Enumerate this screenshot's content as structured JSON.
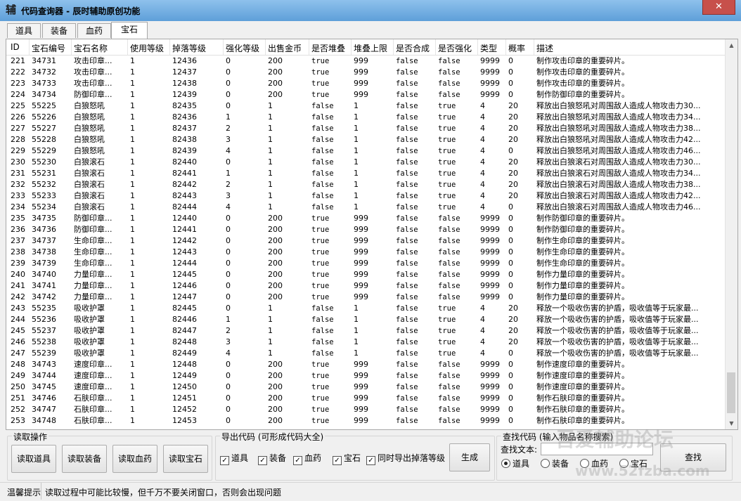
{
  "window": {
    "app_icon_glyph": "辅",
    "title": "代码查询器 - 辰时辅助原创功能",
    "close_label": "✕"
  },
  "tabs": [
    {
      "label": "道具",
      "active": false
    },
    {
      "label": "装备",
      "active": false
    },
    {
      "label": "血药",
      "active": false
    },
    {
      "label": "宝石",
      "active": true
    }
  ],
  "table": {
    "columns": [
      "ID",
      "宝石编号",
      "宝石名称",
      "使用等级",
      "掉落等级",
      "强化等级",
      "出售金币",
      "是否堆叠",
      "堆叠上限",
      "是否合成",
      "是否强化",
      "类型",
      "概率",
      "描述"
    ],
    "rows": [
      [
        "221",
        "34731",
        "攻击印章...",
        "1",
        "12436",
        "0",
        "200",
        "true",
        "999",
        "false",
        "false",
        "9999",
        "0",
        "制作攻击印章的重要碎片。"
      ],
      [
        "222",
        "34732",
        "攻击印章...",
        "1",
        "12437",
        "0",
        "200",
        "true",
        "999",
        "false",
        "false",
        "9999",
        "0",
        "制作攻击印章的重要碎片。"
      ],
      [
        "223",
        "34733",
        "攻击印章...",
        "1",
        "12438",
        "0",
        "200",
        "true",
        "999",
        "false",
        "false",
        "9999",
        "0",
        "制作攻击印章的重要碎片。"
      ],
      [
        "224",
        "34734",
        "防御印章...",
        "1",
        "12439",
        "0",
        "200",
        "true",
        "999",
        "false",
        "false",
        "9999",
        "0",
        "制作防御印章的重要碎片。"
      ],
      [
        "225",
        "55225",
        "白狼怒吼",
        "1",
        "82435",
        "0",
        "1",
        "false",
        "1",
        "false",
        "true",
        "4",
        "20",
        "释放出白狼怒吼对周围敌人造成人物攻击力30..."
      ],
      [
        "226",
        "55226",
        "白狼怒吼",
        "1",
        "82436",
        "1",
        "1",
        "false",
        "1",
        "false",
        "true",
        "4",
        "20",
        "释放出白狼怒吼对周围敌人造成人物攻击力34..."
      ],
      [
        "227",
        "55227",
        "白狼怒吼",
        "1",
        "82437",
        "2",
        "1",
        "false",
        "1",
        "false",
        "true",
        "4",
        "20",
        "释放出白狼怒吼对周围敌人造成人物攻击力38..."
      ],
      [
        "228",
        "55228",
        "白狼怒吼",
        "1",
        "82438",
        "3",
        "1",
        "false",
        "1",
        "false",
        "true",
        "4",
        "20",
        "释放出白狼怒吼对周围敌人造成人物攻击力42..."
      ],
      [
        "229",
        "55229",
        "白狼怒吼",
        "1",
        "82439",
        "4",
        "1",
        "false",
        "1",
        "false",
        "true",
        "4",
        "0",
        "释放出白狼怒吼对周围敌人造成人物攻击力46..."
      ],
      [
        "230",
        "55230",
        "白狼滚石",
        "1",
        "82440",
        "0",
        "1",
        "false",
        "1",
        "false",
        "true",
        "4",
        "20",
        "释放出白狼滚石对周围敌人造成人物攻击力30..."
      ],
      [
        "231",
        "55231",
        "白狼滚石",
        "1",
        "82441",
        "1",
        "1",
        "false",
        "1",
        "false",
        "true",
        "4",
        "20",
        "释放出白狼滚石对周围敌人造成人物攻击力34..."
      ],
      [
        "232",
        "55232",
        "白狼滚石",
        "1",
        "82442",
        "2",
        "1",
        "false",
        "1",
        "false",
        "true",
        "4",
        "20",
        "释放出白狼滚石对周围敌人造成人物攻击力38..."
      ],
      [
        "233",
        "55233",
        "白狼滚石",
        "1",
        "82443",
        "3",
        "1",
        "false",
        "1",
        "false",
        "true",
        "4",
        "20",
        "释放出白狼滚石对周围敌人造成人物攻击力42..."
      ],
      [
        "234",
        "55234",
        "白狼滚石",
        "1",
        "82444",
        "4",
        "1",
        "false",
        "1",
        "false",
        "true",
        "4",
        "0",
        "释放出白狼滚石对周围敌人造成人物攻击力46..."
      ],
      [
        "235",
        "34735",
        "防御印章...",
        "1",
        "12440",
        "0",
        "200",
        "true",
        "999",
        "false",
        "false",
        "9999",
        "0",
        "制作防御印章的重要碎片。"
      ],
      [
        "236",
        "34736",
        "防御印章...",
        "1",
        "12441",
        "0",
        "200",
        "true",
        "999",
        "false",
        "false",
        "9999",
        "0",
        "制作防御印章的重要碎片。"
      ],
      [
        "237",
        "34737",
        "生命印章...",
        "1",
        "12442",
        "0",
        "200",
        "true",
        "999",
        "false",
        "false",
        "9999",
        "0",
        "制作生命印章的重要碎片。"
      ],
      [
        "238",
        "34738",
        "生命印章...",
        "1",
        "12443",
        "0",
        "200",
        "true",
        "999",
        "false",
        "false",
        "9999",
        "0",
        "制作生命印章的重要碎片。"
      ],
      [
        "239",
        "34739",
        "生命印章...",
        "1",
        "12444",
        "0",
        "200",
        "true",
        "999",
        "false",
        "false",
        "9999",
        "0",
        "制作生命印章的重要碎片。"
      ],
      [
        "240",
        "34740",
        "力量印章...",
        "1",
        "12445",
        "0",
        "200",
        "true",
        "999",
        "false",
        "false",
        "9999",
        "0",
        "制作力量印章的重要碎片。"
      ],
      [
        "241",
        "34741",
        "力量印章...",
        "1",
        "12446",
        "0",
        "200",
        "true",
        "999",
        "false",
        "false",
        "9999",
        "0",
        "制作力量印章的重要碎片。"
      ],
      [
        "242",
        "34742",
        "力量印章...",
        "1",
        "12447",
        "0",
        "200",
        "true",
        "999",
        "false",
        "false",
        "9999",
        "0",
        "制作力量印章的重要碎片。"
      ],
      [
        "243",
        "55235",
        "吸收护罩",
        "1",
        "82445",
        "0",
        "1",
        "false",
        "1",
        "false",
        "true",
        "4",
        "20",
        "释放一个吸收伤害的护盾，吸收值等于玩家最..."
      ],
      [
        "244",
        "55236",
        "吸收护罩",
        "1",
        "82446",
        "1",
        "1",
        "false",
        "1",
        "false",
        "true",
        "4",
        "20",
        "释放一个吸收伤害的护盾，吸收值等于玩家最..."
      ],
      [
        "245",
        "55237",
        "吸收护罩",
        "1",
        "82447",
        "2",
        "1",
        "false",
        "1",
        "false",
        "true",
        "4",
        "20",
        "释放一个吸收伤害的护盾，吸收值等于玩家最..."
      ],
      [
        "246",
        "55238",
        "吸收护罩",
        "1",
        "82448",
        "3",
        "1",
        "false",
        "1",
        "false",
        "true",
        "4",
        "20",
        "释放一个吸收伤害的护盾，吸收值等于玩家最..."
      ],
      [
        "247",
        "55239",
        "吸收护罩",
        "1",
        "82449",
        "4",
        "1",
        "false",
        "1",
        "false",
        "true",
        "4",
        "0",
        "释放一个吸收伤害的护盾，吸收值等于玩家最..."
      ],
      [
        "248",
        "34743",
        "速度印章...",
        "1",
        "12448",
        "0",
        "200",
        "true",
        "999",
        "false",
        "false",
        "9999",
        "0",
        "制作速度印章的重要碎片。"
      ],
      [
        "249",
        "34744",
        "速度印章...",
        "1",
        "12449",
        "0",
        "200",
        "true",
        "999",
        "false",
        "false",
        "9999",
        "0",
        "制作速度印章的重要碎片。"
      ],
      [
        "250",
        "34745",
        "速度印章...",
        "1",
        "12450",
        "0",
        "200",
        "true",
        "999",
        "false",
        "false",
        "9999",
        "0",
        "制作速度印章的重要碎片。"
      ],
      [
        "251",
        "34746",
        "石肤印章...",
        "1",
        "12451",
        "0",
        "200",
        "true",
        "999",
        "false",
        "false",
        "9999",
        "0",
        "制作石肤印章的重要碎片。"
      ],
      [
        "252",
        "34747",
        "石肤印章...",
        "1",
        "12452",
        "0",
        "200",
        "true",
        "999",
        "false",
        "false",
        "9999",
        "0",
        "制作石肤印章的重要碎片。"
      ],
      [
        "253",
        "34748",
        "石肤印章...",
        "1",
        "12453",
        "0",
        "200",
        "true",
        "999",
        "false",
        "false",
        "9999",
        "0",
        "制作石肤印章的重要碎片。"
      ]
    ]
  },
  "read_group": {
    "title": "读取操作",
    "buttons": [
      "读取道具",
      "读取装备",
      "读取血药",
      "读取宝石"
    ]
  },
  "export_group": {
    "title": "导出代码 (可形成代码大全)",
    "checkboxes": [
      {
        "label": "道具",
        "checked": true
      },
      {
        "label": "装备",
        "checked": true
      },
      {
        "label": "血药",
        "checked": true
      },
      {
        "label": "宝石",
        "checked": true
      },
      {
        "label": "同时导出掉落等级",
        "checked": true
      }
    ],
    "generate_label": "生成"
  },
  "search_group": {
    "title": "查找代码 (输入物品名称搜索)",
    "text_label": "查找文本:",
    "value": "",
    "radios": [
      {
        "label": "道具",
        "selected": true
      },
      {
        "label": "装备",
        "selected": false
      },
      {
        "label": "血药",
        "selected": false
      },
      {
        "label": "宝石",
        "selected": false
      }
    ],
    "search_label": "查找"
  },
  "status": {
    "label": "温馨提示",
    "message": "读取过程中可能比较慢，但千万不要关闭窗口，否则会出现问题"
  },
  "watermark": {
    "line1": "吾爱辅助论坛",
    "line2": "www.52fzba.com"
  },
  "colors": {
    "titlebar": "#6fa8dc",
    "close": "#c7504b"
  }
}
